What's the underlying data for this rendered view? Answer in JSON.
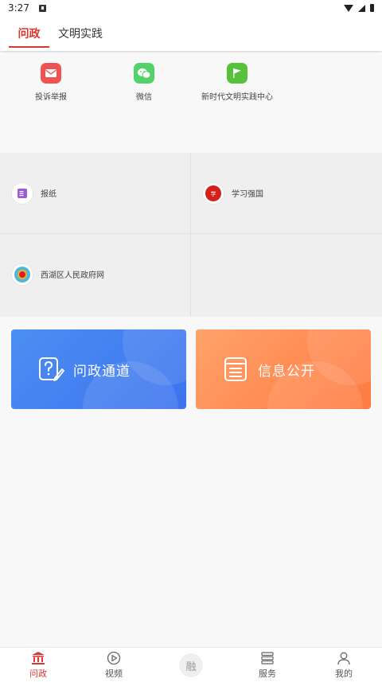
{
  "status": {
    "time": "3:27"
  },
  "tabs": [
    {
      "label": "问政",
      "active": true
    },
    {
      "label": "文明实践",
      "active": false
    }
  ],
  "shortcuts": [
    {
      "label": "投诉举报",
      "icon": "mail-icon",
      "color": "#ee5252"
    },
    {
      "label": "微信",
      "icon": "wechat-icon",
      "color": "#53d16b"
    },
    {
      "label": "新时代文明实践中心",
      "icon": "flag-icon",
      "color": "#56c23c"
    }
  ],
  "grid": [
    {
      "label": "报纸",
      "icon": "newspaper-icon"
    },
    {
      "label": "学习强国",
      "icon": "xuexi-icon"
    },
    {
      "label": "西湖区人民政府网",
      "icon": "emblem-icon"
    }
  ],
  "cards": [
    {
      "label": "问政通道",
      "icon": "question-note-icon",
      "color": "#4a86f2"
    },
    {
      "label": "信息公开",
      "icon": "document-list-icon",
      "color": "#ff8a4f"
    }
  ],
  "bottom_nav": [
    {
      "label": "问政",
      "icon": "government-icon",
      "active": true
    },
    {
      "label": "视频",
      "icon": "play-circle-icon",
      "active": false
    },
    {
      "label": "融",
      "icon": "rong-center-icon",
      "active": false
    },
    {
      "label": "服务",
      "icon": "service-list-icon",
      "active": false
    },
    {
      "label": "我的",
      "icon": "user-icon",
      "active": false
    }
  ],
  "colors": {
    "accent": "#e0352f"
  }
}
